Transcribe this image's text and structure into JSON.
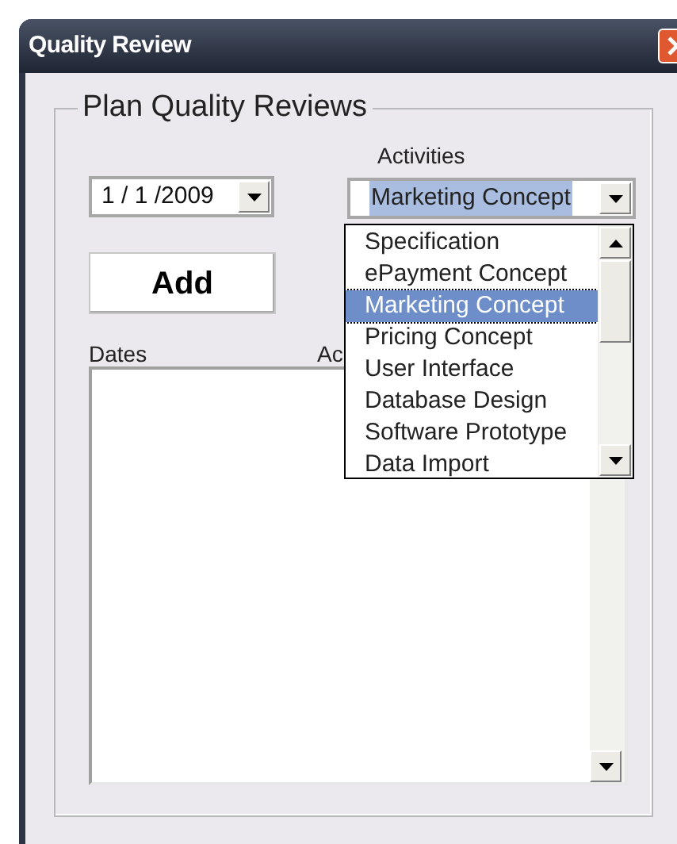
{
  "window": {
    "title": "Quality Review"
  },
  "group": {
    "title": "Plan Quality Reviews"
  },
  "date_picker": {
    "value": "1 / 1 /2009"
  },
  "activities": {
    "label": "Activities",
    "value": "Marketing Concept",
    "expanded": true,
    "options": [
      {
        "label": "Specification",
        "selected": false
      },
      {
        "label": "ePayment Concept",
        "selected": false
      },
      {
        "label": "Marketing Concept",
        "selected": true
      },
      {
        "label": "Pricing Concept",
        "selected": false
      },
      {
        "label": "User Interface",
        "selected": false
      },
      {
        "label": "Database Design",
        "selected": false
      },
      {
        "label": "Software Prototype",
        "selected": false
      },
      {
        "label": "Data Import",
        "selected": false
      }
    ]
  },
  "add_button": {
    "label": "Add"
  },
  "reviews_list": {
    "columns": [
      "Dates",
      "Ac"
    ]
  }
}
